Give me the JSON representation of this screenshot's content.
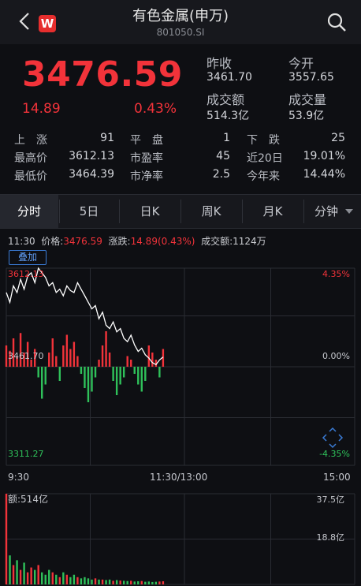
{
  "header": {
    "title": "有色金属(申万)",
    "code": "801050.SI",
    "logo_letter": "W",
    "back_icon": "chevron-left-icon",
    "search_icon": "search-icon"
  },
  "quote": {
    "price": "3476.59",
    "change": "14.89",
    "change_pct": "0.43%",
    "prev_close_label": "昨收",
    "prev_close": "3461.70",
    "open_label": "今开",
    "open": "3557.65",
    "turnover_label": "成交额",
    "turnover": "514.3亿",
    "volume_label": "成交量",
    "volume": "53.9亿"
  },
  "stats": {
    "up_label": "上　涨",
    "up": "91",
    "flat_label": "平　盘",
    "flat": "1",
    "down_label": "下　跌",
    "down": "25",
    "high_label": "最高价",
    "high": "3612.13",
    "pe_label": "市盈率",
    "pe": "45",
    "d20_label": "近20日",
    "d20": "19.01%",
    "low_label": "最低价",
    "low": "3464.39",
    "pb_label": "市净率",
    "pb": "2.5",
    "ytd_label": "今年来",
    "ytd": "14.44%"
  },
  "tabs": [
    "分时",
    "5日",
    "日K",
    "周K",
    "月K",
    "分钟"
  ],
  "chart_info": {
    "time": "11:30",
    "price_label": "价格:",
    "price": "3476.59",
    "chg_label": "涨跌:",
    "chg": "14.89(0.43%)",
    "amount_label": "成交额:",
    "amount": "1124万"
  },
  "overlay_label": "叠加",
  "colors": {
    "up": "#f2333a",
    "down": "#2fc15a",
    "accent": "#3a7bd5",
    "line": "#ffffff"
  },
  "chart_data": {
    "type": "line",
    "title": "",
    "prev_close": 3461.7,
    "y_labels": {
      "top": "3612.13",
      "mid": "3461.70",
      "bottom": "3311.27"
    },
    "pct_labels": {
      "top": "4.35%",
      "mid": "0.00%",
      "bottom": "-4.35%"
    },
    "x_labels": [
      "9:30",
      "11:30/13:00",
      "15:00"
    ],
    "price": [
      3575,
      3560,
      3585,
      3575,
      3595,
      3580,
      3600,
      3605,
      3590,
      3612,
      3605,
      3598,
      3585,
      3590,
      3575,
      3580,
      3570,
      3585,
      3578,
      3575,
      3590,
      3580,
      3570,
      3560,
      3550,
      3555,
      3535,
      3545,
      3525,
      3520,
      3530,
      3515,
      3520,
      3505,
      3500,
      3510,
      3495,
      3485,
      3490,
      3480,
      3475,
      3468,
      3465,
      3472,
      3476.59
    ],
    "macd_bars": [
      60,
      45,
      80,
      30,
      95,
      40,
      70,
      20,
      50,
      -30,
      -90,
      -50,
      40,
      80,
      30,
      -40,
      60,
      90,
      50,
      70,
      30,
      -20,
      -60,
      -100,
      -70,
      -30,
      20,
      60,
      100,
      40,
      -40,
      -80,
      -50,
      -30,
      30,
      20,
      -20,
      -50,
      -70,
      -40,
      60,
      40,
      20,
      -30,
      50
    ],
    "volume_axis": {
      "top": "37.5亿",
      "mid": "18.8亿"
    },
    "volume_label": "额:514亿",
    "volume": [
      37.5,
      12,
      8,
      10,
      6,
      9,
      5,
      7,
      6,
      8,
      5,
      4,
      6,
      5,
      4,
      3,
      5,
      4,
      3,
      4,
      3,
      2.5,
      3,
      2.5,
      2,
      2.5,
      2,
      2,
      1.8,
      2,
      1.5,
      1.8,
      1.6,
      1.5,
      1.4,
      1.5,
      1.2,
      1.3,
      1.4,
      1.1,
      1.2,
      1,
      1.1,
      1.2,
      1.3
    ]
  }
}
